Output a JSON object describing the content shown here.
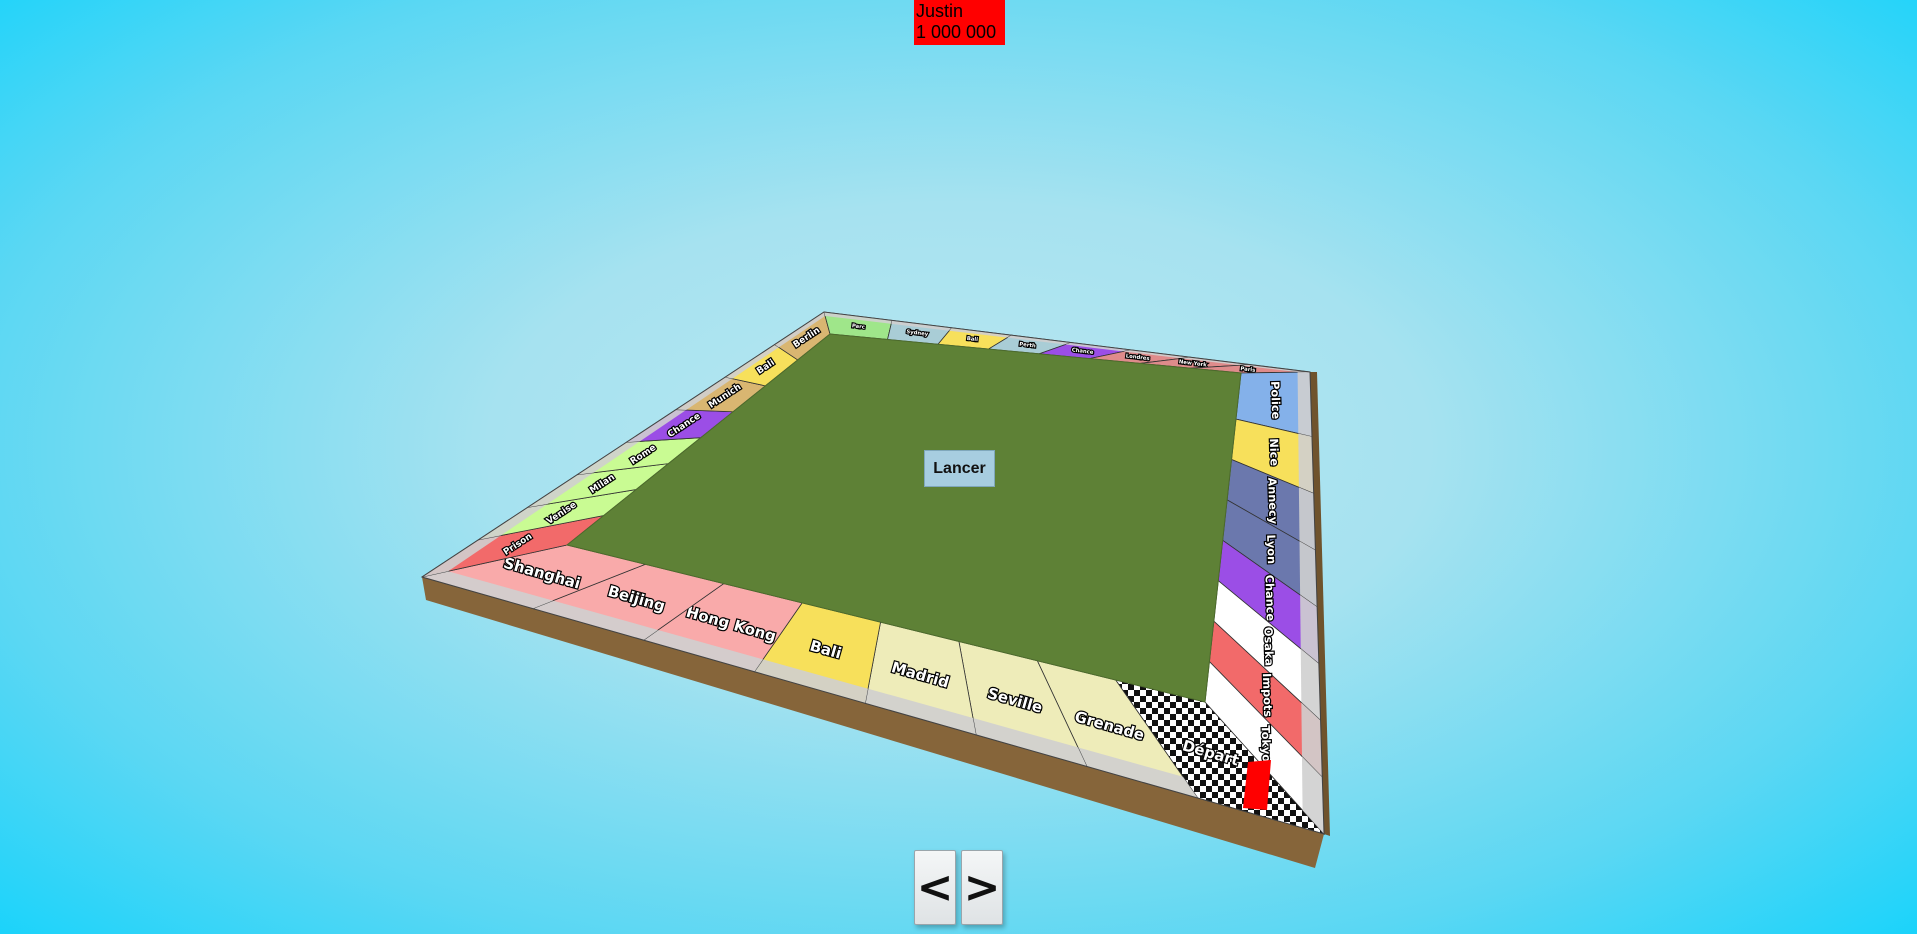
{
  "player": {
    "name": "Justin",
    "money": "1 000 000",
    "color": "#ff0000"
  },
  "board": {
    "center_color": "#5e8136",
    "side_color": "#86653a",
    "cells": [
      {
        "name": "Départ",
        "color": "checker"
      },
      {
        "name": "Grenade",
        "color": "#eeecb9"
      },
      {
        "name": "Seville",
        "color": "#eeecb9"
      },
      {
        "name": "Madrid",
        "color": "#eeecb9"
      },
      {
        "name": "Bali",
        "color": "#f7e05b"
      },
      {
        "name": "Hong Kong",
        "color": "#f9aaaa"
      },
      {
        "name": "Beijing",
        "color": "#f9aaaa"
      },
      {
        "name": "Shanghai",
        "color": "#f9aaaa"
      },
      {
        "name": "Prison",
        "color": "#f26a6a"
      },
      {
        "name": "Venise",
        "color": "#c9fb93"
      },
      {
        "name": "Milan",
        "color": "#c9fb93"
      },
      {
        "name": "Rome",
        "color": "#c9fb93"
      },
      {
        "name": "Chance",
        "color": "#9b4ee6"
      },
      {
        "name": "Munich",
        "color": "#d9b671"
      },
      {
        "name": "Bali",
        "color": "#f7e05b"
      },
      {
        "name": "Berlin",
        "color": "#d9b671"
      },
      {
        "name": "Parc",
        "color": "#9fe68a"
      },
      {
        "name": "Sydney",
        "color": "#a9cdd6"
      },
      {
        "name": "Bali",
        "color": "#f7e05b"
      },
      {
        "name": "Perth",
        "color": "#a9cdd6"
      },
      {
        "name": "Chance",
        "color": "#9b4ee6"
      },
      {
        "name": "Londres",
        "color": "#df8b8b"
      },
      {
        "name": "New York",
        "color": "#df8b8b"
      },
      {
        "name": "Paris",
        "color": "#df8b8b"
      },
      {
        "name": "Police",
        "color": "#84b1ea"
      },
      {
        "name": "Nice",
        "color": "#f7e05b"
      },
      {
        "name": "Annecy",
        "color": "#6b78ad"
      },
      {
        "name": "Lyon",
        "color": "#6b78ad"
      },
      {
        "name": "Chance",
        "color": "#9b4ee6"
      },
      {
        "name": "Osaka",
        "color": "#ffffff"
      },
      {
        "name": "Impots",
        "color": "#f26a6a"
      },
      {
        "name": "Tokyo",
        "color": "#ffffff"
      }
    ]
  },
  "controls": {
    "roll_label": "Lancer",
    "prev_label": "<",
    "next_label": ">"
  }
}
